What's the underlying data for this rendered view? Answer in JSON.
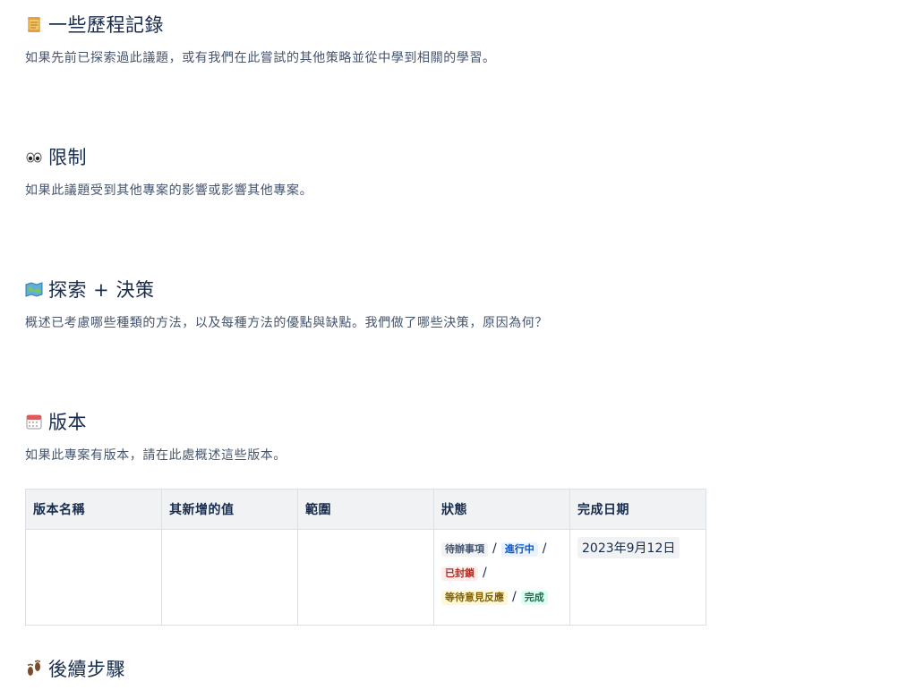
{
  "sections": {
    "history": {
      "icon": "scroll-icon",
      "title": "一些歷程記錄",
      "description": "如果先前已探索過此議題，或有我們在此嘗試的其他策略並從中學到相關的學習。"
    },
    "constraints": {
      "icon": "eyes-icon",
      "title": "限制",
      "description": "如果此議題受到其他專案的影響或影響其他專案。"
    },
    "exploration": {
      "icon": "map-icon",
      "title": "探索 + 決策",
      "description": "概述已考慮哪些種類的方法，以及每種方法的優點與缺點。我們做了哪些決策，原因為何？"
    },
    "versions": {
      "icon": "calendar-icon",
      "title": "版本",
      "description": "如果此專案有版本，請在此處概述這些版本。"
    },
    "next_steps": {
      "icon": "footprints-icon",
      "title": "後續步驟"
    }
  },
  "versions_table": {
    "headers": [
      "版本名稱",
      "其新增的值",
      "範圍",
      "狀態",
      "完成日期"
    ],
    "row": {
      "name": "",
      "value_added": "",
      "scope": "",
      "statuses": [
        {
          "label": "待辦事項",
          "color": "#44546f"
        },
        {
          "label": "進行中",
          "color": "#0055cc"
        },
        {
          "label": "已封鎖",
          "color": "#ae2e24"
        },
        {
          "label": "等待意見反應",
          "color": "#7f5f01"
        },
        {
          "label": "完成",
          "color": "#216e4e"
        }
      ],
      "separator": "/",
      "completion_date": "2023年9月12日"
    }
  }
}
